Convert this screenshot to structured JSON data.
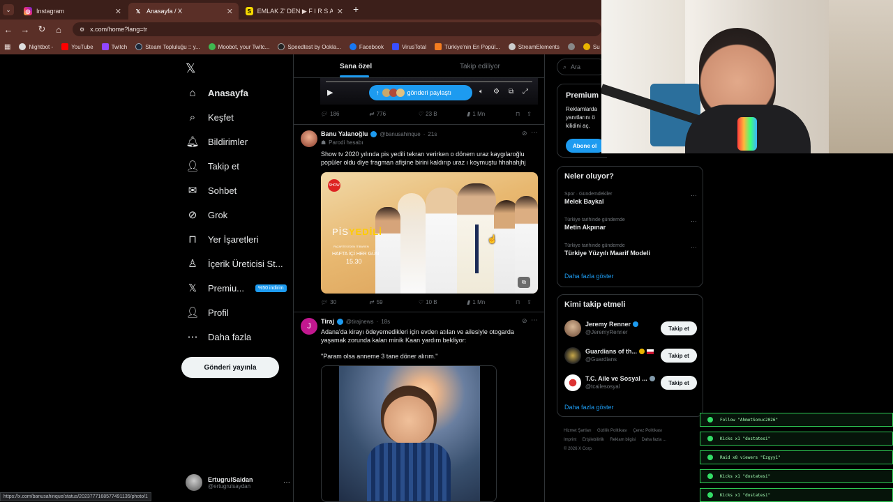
{
  "browser": {
    "tabs": [
      {
        "title": "Instagram",
        "favicon": "instagram-icon",
        "active": false
      },
      {
        "title": "Anasayfa / X",
        "favicon": "x-logo-icon",
        "active": true
      },
      {
        "title": "EMLAK Z' DEN ▶ F I R S A T I",
        "favicon": "s-icon",
        "active": false
      }
    ],
    "url": "x.com/home?lang=tr",
    "bookmarks": [
      "Nightbot -",
      "YouTube",
      "Twitch",
      "Steam Topluluğu :: y...",
      "Moobot, your Twitc...",
      "Speedtest by Ookla...",
      "Facebook",
      "VirusTotal",
      "Türkiye'nin En Popül...",
      "StreamElements",
      "Su"
    ],
    "status_url": "https://x.com/banusahinque/status/2023777168577491135/photo/1"
  },
  "sidebar": {
    "items": [
      {
        "label": "Anasayfa",
        "icon": "home-icon",
        "bold": true
      },
      {
        "label": "Keşfet",
        "icon": "search-icon"
      },
      {
        "label": "Bildirimler",
        "icon": "bell-icon"
      },
      {
        "label": "Takip et",
        "icon": "add-user-icon"
      },
      {
        "label": "Sohbet",
        "icon": "mail-icon"
      },
      {
        "label": "Grok",
        "icon": "grok-icon"
      },
      {
        "label": "Yer İşaretleri",
        "icon": "bookmark-icon"
      },
      {
        "label": "İçerik Üreticisi St...",
        "icon": "creator-icon"
      },
      {
        "label": "Premiu...",
        "icon": "x-logo-icon",
        "badge": "%50 indirim"
      },
      {
        "label": "Profil",
        "icon": "profile-icon"
      },
      {
        "label": "Daha fazla",
        "icon": "more-icon"
      }
    ],
    "post_button": "Gönderi yayınla",
    "account": {
      "name": "ErtugrulSaidan",
      "handle": "@ertugrulsaydan"
    }
  },
  "timeline": {
    "tabs": [
      "Sana özel",
      "Takip ediliyor"
    ],
    "new_posts_pill": "gönderi paylaştı",
    "tweets": [
      {
        "stats": {
          "replies": "186",
          "retweets": "776",
          "likes": "23 B",
          "views": "1 Mn"
        }
      },
      {
        "name": "Banu Yalanoğlu",
        "handle": "@banusahinque",
        "time": "21s",
        "tag": "Parodi hesabı",
        "text": "Show tv 2020 yılında pis yedili tekrarı verirken o dönem uraz kaygılaroğlu popüler oldu diye fragman afişine birini kaldırıp uraz ı koymuştu hhahahjhj",
        "image": {
          "logo": "PİS YEDİLİ",
          "line1": "PAZARTESİ'DEN İTİBAREN",
          "line2": "HAFTA İÇİ HER GÜN",
          "time": "15.30"
        },
        "stats": {
          "replies": "30",
          "retweets": "59",
          "likes": "10 B",
          "views": "1 Mn"
        }
      },
      {
        "name": "Tiraj",
        "handle": "@tirajnews",
        "time": "18s",
        "text": "Adana'da kirayı ödeyemedikleri için evden atılan ve ailesiyle otogarda yaşamak zorunda kalan minik Kaan yardım bekliyor:",
        "quote": "\"Param olsa anneme 3 tane döner alırım.\""
      }
    ]
  },
  "right": {
    "search_placeholder": "Ara",
    "premium": {
      "title": "Premium",
      "text1": "Reklamlarda",
      "text2": "yanıtlarını ö",
      "text3": "kilidini aç.",
      "button": "Abone ol"
    },
    "trends_title": "Neler oluyor?",
    "trends": [
      {
        "meta": "Spor · Gündemdekiler",
        "name": "Melek Baykal"
      },
      {
        "meta": "Türkiye tarihinde gündemde",
        "name": "Metin Akpınar"
      },
      {
        "meta": "Türkiye tarihinde gündemde",
        "name": "Türkiye Yüzyılı Maarif Modeli"
      }
    ],
    "show_more": "Daha fazla göster",
    "who_title": "Kimi takip etmeli",
    "who": [
      {
        "name": "Jeremy Renner",
        "handle": "@JeremyRenner"
      },
      {
        "name": "Guardians of th...",
        "handle": "@Guardians"
      },
      {
        "name": "T.C. Aile ve Sosyal ...",
        "handle": "@tcailesosyal"
      }
    ],
    "follow_label": "Takip et",
    "footer": [
      "Hizmet Şartları",
      "Gizlilik Politikası",
      "Çerez Politikası",
      "Imprint",
      "Erişilebilirlik",
      "Reklam bilgisi",
      "Daha fazla ...",
      "© 2026 X Corp."
    ]
  },
  "overlay": {
    "alerts": [
      "Follow \"AhmetSonuc2026\"",
      "Kicks x1 \"dostatesi\"",
      "Raid x8 viewers \"Ezgyy1\"",
      "Kicks x1 \"dostatesi\"",
      "Kicks x1 \"dostatesi\""
    ]
  },
  "colors": {
    "accent": "#1d9bf0",
    "chrome": "#5a2f27",
    "overlay_green": "#2ecc55"
  }
}
